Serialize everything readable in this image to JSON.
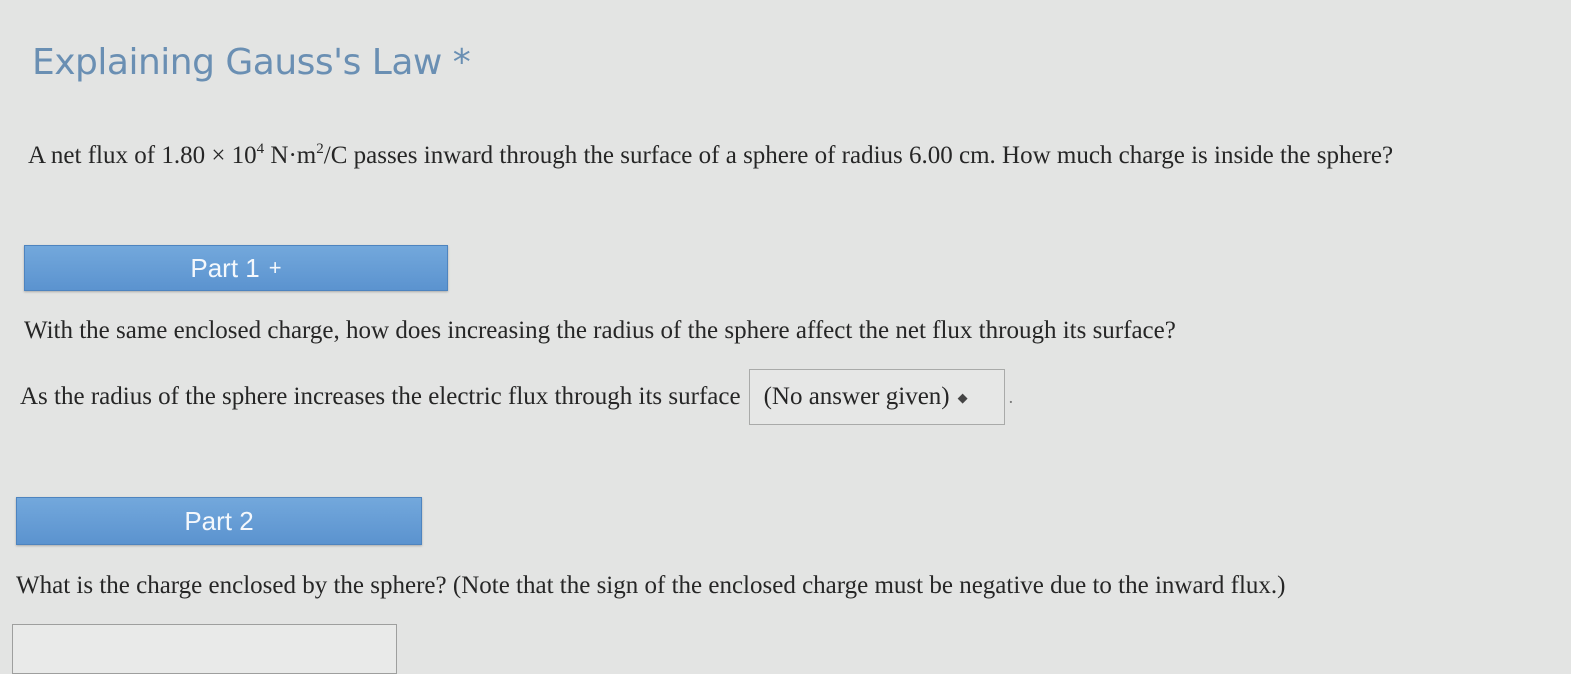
{
  "title": "Explaining Gauss's Law *",
  "question": {
    "before": "A net flux of 1.80 × 10",
    "exp": "4",
    "mid": " N·m",
    "exp2": "2",
    "after": "/C passes inward through the surface of a sphere of radius 6.00 cm. How much charge is inside the sphere?"
  },
  "part1": {
    "label": "Part 1",
    "expand_symbol": "+",
    "question": "With the same enclosed charge, how does increasing the radius of the sphere affect the net flux through its surface?",
    "answer_prefix": "As the radius of the sphere increases the electric flux through its surface",
    "select_value": "(No answer given)",
    "select_arrows": "◆",
    "trailing": "."
  },
  "part2": {
    "label": "Part 2",
    "question": "What is the charge enclosed by the sphere? (Note that the sign of the enclosed charge must be negative due to the inward flux.)"
  },
  "colors": {
    "title": "#6a8fb3",
    "part_bar": "#5b93cf",
    "background": "#e3e4e3"
  }
}
